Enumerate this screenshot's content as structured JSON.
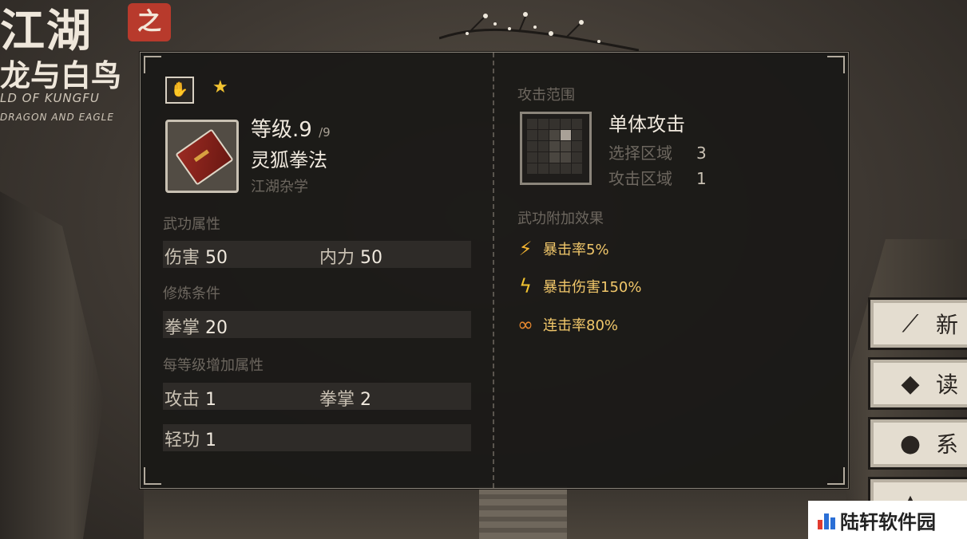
{
  "background": {
    "logo": {
      "title_line1": "江湖",
      "seal": "之",
      "title_line2": "龙与白鸟",
      "en_line1": "LD OF KUNGFU",
      "en_line2": "DRAGON AND EAGLE"
    }
  },
  "side_menu": [
    {
      "icon": "brush-icon",
      "label": "新"
    },
    {
      "icon": "book-icon",
      "label": "读"
    },
    {
      "icon": "pot-icon",
      "label": "系"
    }
  ],
  "watermark": "陆轩软件园",
  "panel": {
    "level_label": "等级",
    "level_value": ".9",
    "level_max": "/9",
    "skill_name": "灵狐拳法",
    "skill_category": "江湖杂学",
    "attributes_title": "武功属性",
    "attributes": [
      {
        "key": "伤害",
        "value": "50"
      },
      {
        "key": "内力",
        "value": "50"
      }
    ],
    "requirements_title": "修炼条件",
    "requirements": [
      {
        "key": "拳掌",
        "value": "20"
      }
    ],
    "per_level_title": "每等级增加属性",
    "per_level": [
      {
        "key": "攻击",
        "value": "1"
      },
      {
        "key": "拳掌",
        "value": "2"
      },
      {
        "key": "轻功",
        "value": "1"
      }
    ],
    "range_title": "攻击范围",
    "attack_type": "单体攻击",
    "select_area_label": "选择区域",
    "select_area_value": "3",
    "attack_area_label": "攻击区域",
    "attack_area_value": "1",
    "effects_title": "武功附加效果",
    "effects": [
      {
        "icon": "crit-rate-icon",
        "text": "暴击率5%"
      },
      {
        "icon": "crit-damage-icon",
        "text": "暴击伤害150%"
      },
      {
        "icon": "combo-rate-icon",
        "text": "连击率80%"
      }
    ]
  },
  "colors": {
    "effect_text": "#f1c76a",
    "star": "#f3c431",
    "seal": "#b83a2c"
  }
}
